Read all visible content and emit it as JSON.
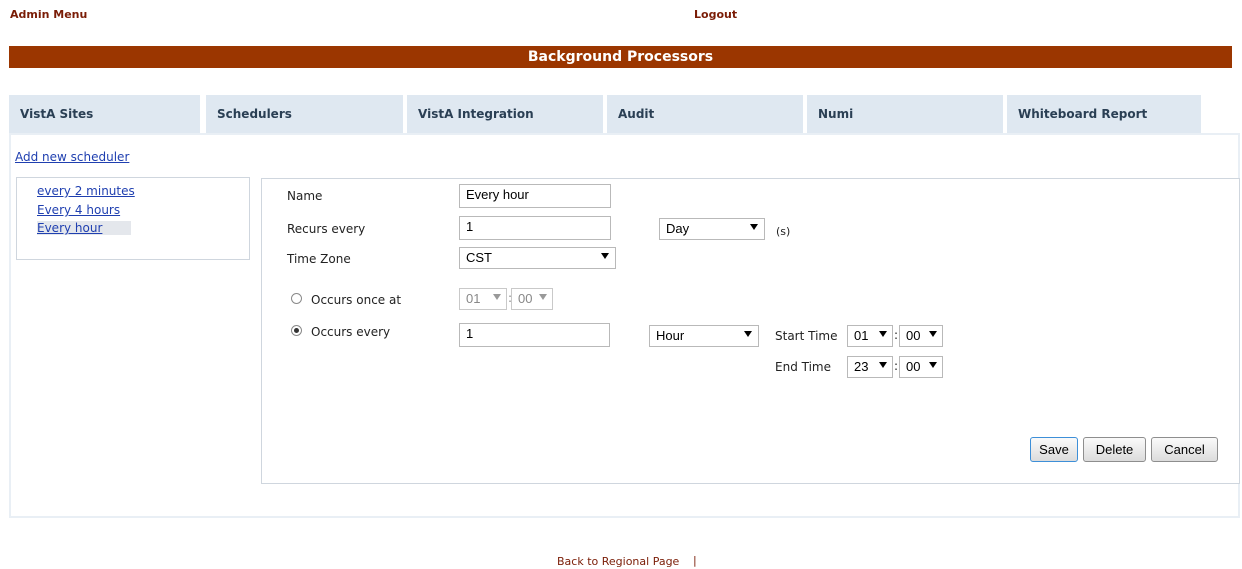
{
  "top": {
    "admin_menu": "Admin Menu",
    "logout": "Logout"
  },
  "banner": {
    "title": "Background Processors"
  },
  "tabs": [
    {
      "label": "VistA Sites"
    },
    {
      "label": "Schedulers"
    },
    {
      "label": "VistA Integration"
    },
    {
      "label": "Audit"
    },
    {
      "label": "Numi"
    },
    {
      "label": "Whiteboard Report"
    }
  ],
  "scheduler": {
    "add_new": "Add new scheduler",
    "items": [
      {
        "label": "every 2 minutes"
      },
      {
        "label": "Every 4 hours"
      },
      {
        "label": "Every hour",
        "selected": true
      }
    ]
  },
  "form": {
    "name_label": "Name",
    "name_value": "Every hour",
    "recurs_label": "Recurs every",
    "recurs_value": "1",
    "recurs_unit": "Day",
    "recurs_suffix": "(s)",
    "timezone_label": "Time Zone",
    "timezone_value": "CST",
    "once_label": "Occurs once at",
    "once_hour": "01",
    "once_minute": "00",
    "once_separator": ":",
    "every_label": "Occurs every",
    "every_value": "1",
    "every_unit": "Hour",
    "start_label": "Start Time",
    "start_hour": "01",
    "start_minute": "00",
    "end_label": "End Time",
    "end_hour": "23",
    "end_minute": "00",
    "time_separator": ":",
    "selected_option": "occurs-every"
  },
  "buttons": {
    "save": "Save",
    "delete": "Delete",
    "cancel": "Cancel"
  },
  "footer": {
    "back_link": "Back to Regional Page",
    "separator": "|"
  },
  "colors": {
    "banner": "#9b3600",
    "tab_bg": "#dfe8f1",
    "link": "#1f3fb0",
    "nav": "#7a1c06"
  }
}
